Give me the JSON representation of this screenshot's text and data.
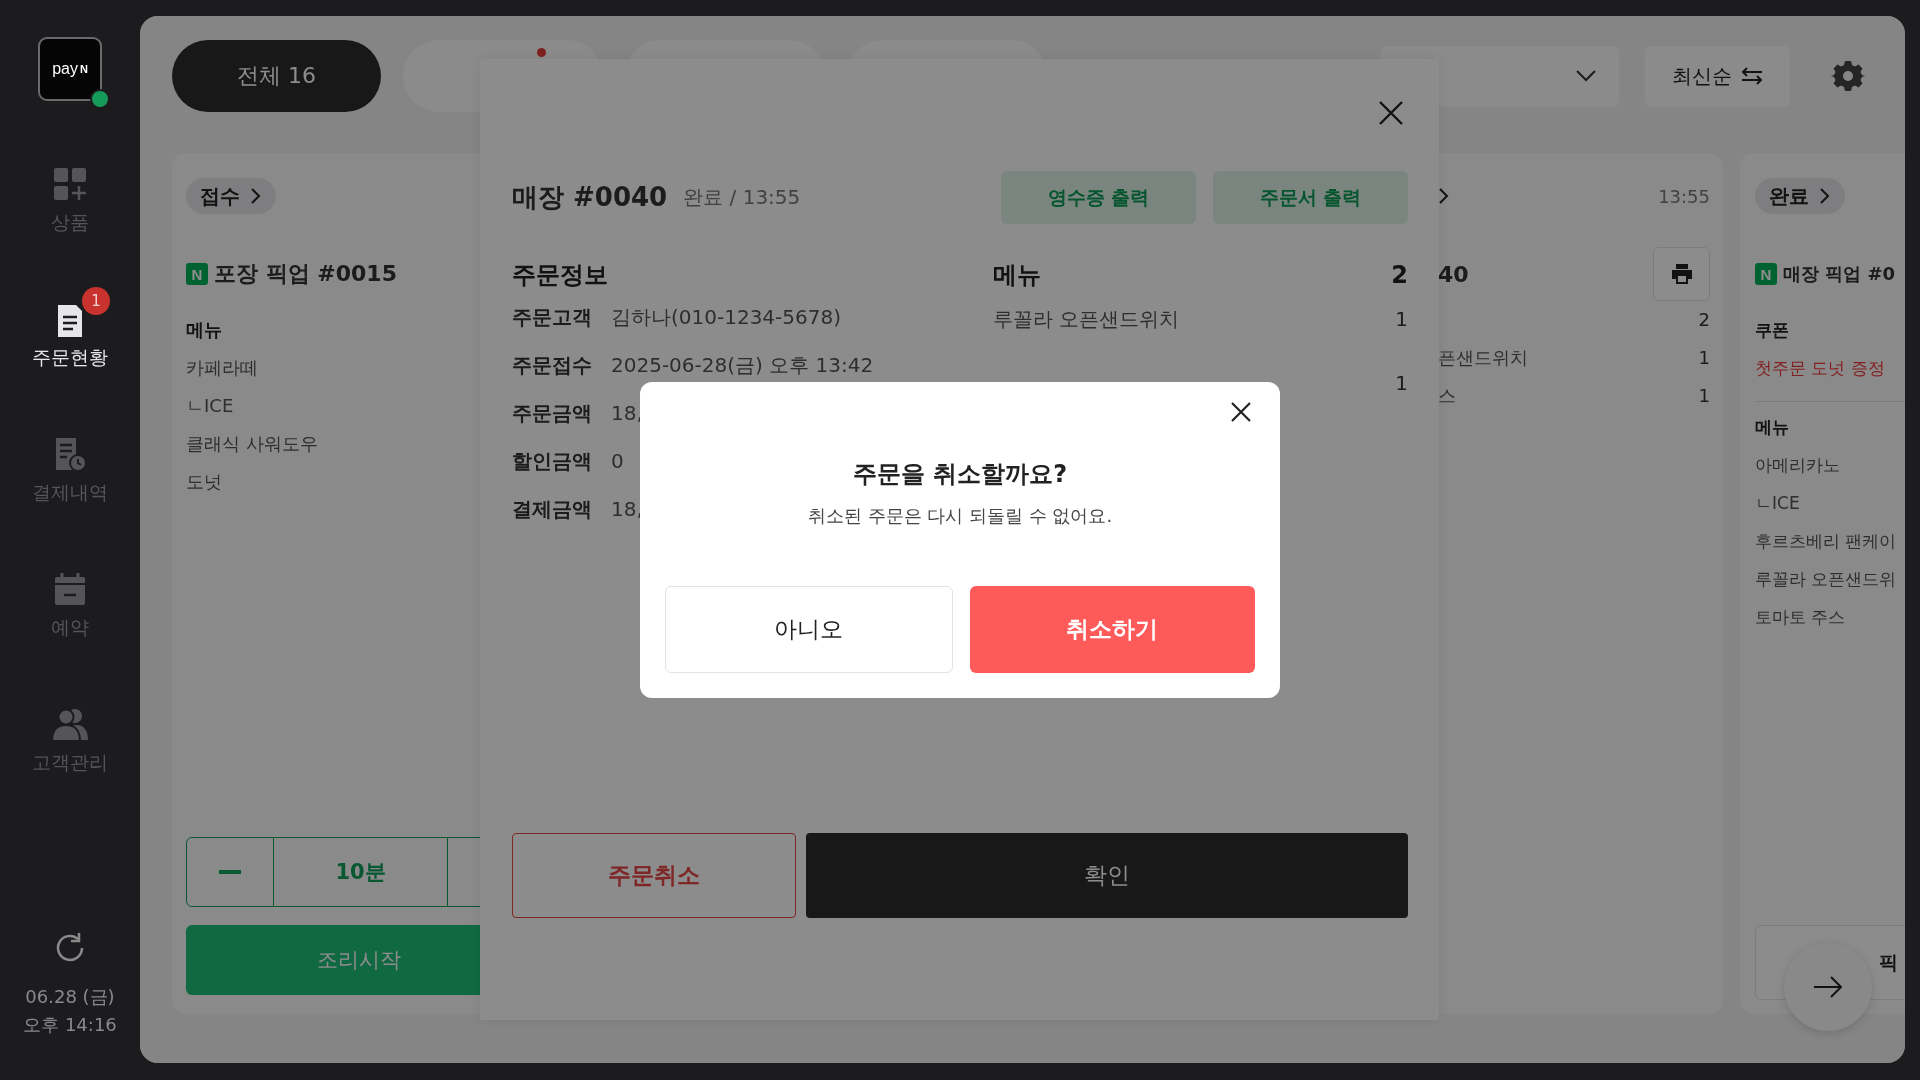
{
  "sidebar": {
    "logo": {
      "text": "pay",
      "mark": "N",
      "online": true
    },
    "items": [
      {
        "label": "상품",
        "selected": false
      },
      {
        "label": "주문현황",
        "selected": true,
        "badge": "1"
      },
      {
        "label": "결제내역",
        "selected": false
      },
      {
        "label": "예약",
        "selected": false
      },
      {
        "label": "고객관리",
        "selected": false
      }
    ],
    "date": "06.28 (금)",
    "time": "오후 14:16"
  },
  "filter_tabs": [
    {
      "label": "전체 16",
      "selected": true,
      "alert": false
    },
    {
      "selected": false,
      "alert": true
    },
    {
      "selected": false,
      "alert": false
    },
    {
      "selected": false,
      "alert": false
    }
  ],
  "dropdown": {
    "expanded": false
  },
  "sort_button": {
    "label": "최신순"
  },
  "columns": [
    {
      "kind": "full",
      "status": "접수",
      "channel": "N",
      "title": "포장 픽업 #0015",
      "sections": [
        {
          "heading": "메뉴",
          "lines": [
            {
              "name": "카페라떼"
            },
            {
              "name": "ㄴICE"
            },
            {
              "name": "클래식 사워도우"
            },
            {
              "name": "도넛"
            }
          ]
        }
      ],
      "prep_time": "10분",
      "action": "조리시작"
    },
    {
      "kind": "partial",
      "time": "13:55",
      "title": "40",
      "sections": [
        {
          "lines": [
            {
              "count": "2"
            },
            {
              "name": "픈샌드위치",
              "count": "1"
            },
            {
              "name": "스",
              "count": "1"
            }
          ]
        }
      ]
    },
    {
      "kind": "full",
      "status": "완료",
      "channel": "N",
      "title": "매장 픽업 #0",
      "sections": [
        {
          "heading": "쿠폰",
          "lines": [
            {
              "name": "첫주문 도넛 증정",
              "coupon": true
            }
          ]
        },
        {
          "heading": "메뉴",
          "lines": [
            {
              "name": "아메리카노"
            },
            {
              "name": "ㄴICE"
            },
            {
              "name": "후르츠베리 팬케이"
            },
            {
              "name": "루꼴라 오픈샌드위"
            },
            {
              "name": "토마토 주스"
            }
          ]
        }
      ],
      "footer": "픽"
    }
  ],
  "detail_panel": {
    "title": "매장 #0040",
    "status": "완료 / 13:55",
    "print_buttons": [
      "영수증 출력",
      "주문서 출력"
    ],
    "info": {
      "heading": "주문정보",
      "rows": [
        {
          "label": "주문고객",
          "value": "김하나(010-1234-5678)"
        },
        {
          "label": "주문접수",
          "value": "2025-06-28(금) 오후 13:42"
        },
        {
          "label": "주문금액",
          "value": "18,"
        },
        {
          "label": "할인금액",
          "value": "0"
        },
        {
          "label": "결제금액",
          "value": "18,"
        }
      ]
    },
    "menu": {
      "heading": "메뉴",
      "count": "2",
      "items": [
        {
          "name": "루꼴라 오픈샌드위치",
          "count": "1"
        },
        {
          "count": "1"
        }
      ]
    },
    "cancel_button": "주문취소",
    "confirm_button": "확인"
  },
  "dialog": {
    "title": "주문을 취소할까요?",
    "message": "취소된 주문은 다시 되돌릴 수 없어요.",
    "buttons": [
      {
        "label": "아니오",
        "kind": "secondary"
      },
      {
        "label": "취소하기",
        "kind": "danger"
      }
    ]
  }
}
